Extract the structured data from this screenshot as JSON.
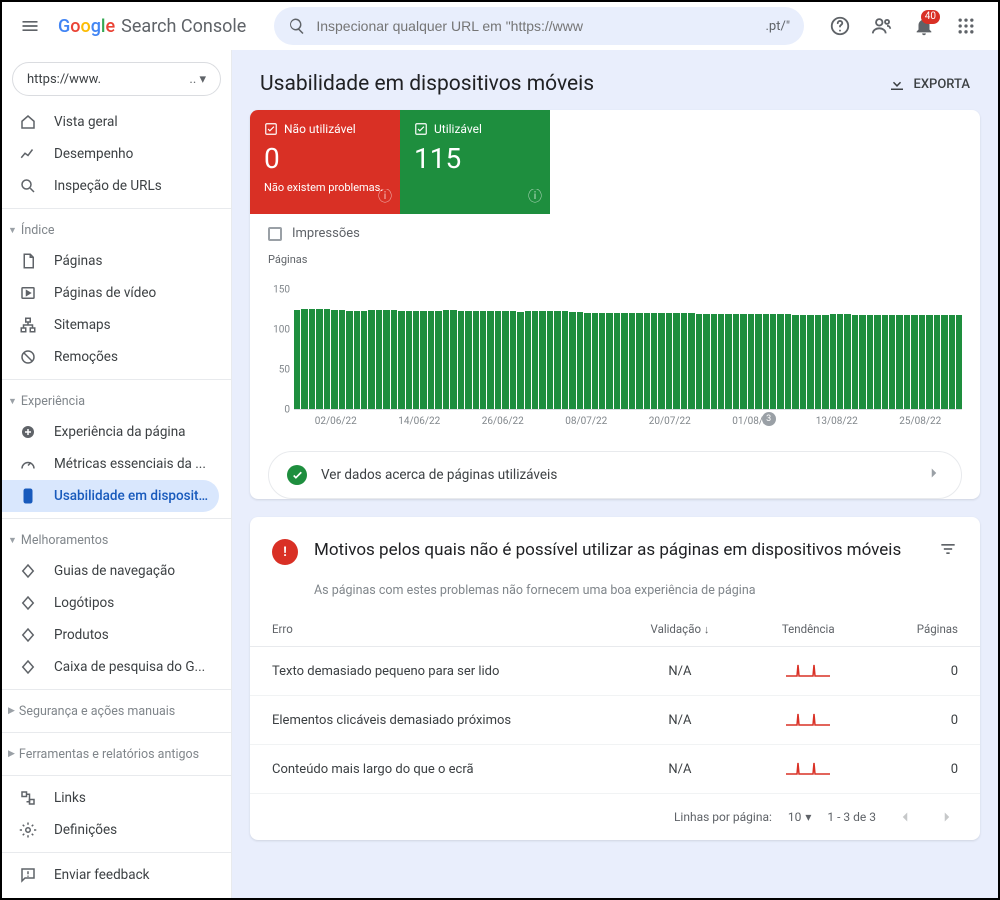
{
  "header": {
    "product": "Search Console",
    "search_placeholder": "Inspecionar qualquer URL em \"https://www",
    "search_suffix": ".pt/\"",
    "notif_count": "40"
  },
  "property": {
    "label": "https://www.",
    "suffix": ".. ▾"
  },
  "sidebar": {
    "items_top": [
      {
        "label": "Vista geral",
        "icon": "home"
      },
      {
        "label": "Desempenho",
        "icon": "trend"
      },
      {
        "label": "Inspeção de URLs",
        "icon": "search"
      }
    ],
    "group_indice": "Índice",
    "items_indice": [
      {
        "label": "Páginas",
        "icon": "page"
      },
      {
        "label": "Páginas de vídeo",
        "icon": "video"
      },
      {
        "label": "Sitemaps",
        "icon": "sitemap"
      },
      {
        "label": "Remoções",
        "icon": "remove"
      }
    ],
    "group_exp": "Experiência",
    "items_exp": [
      {
        "label": "Experiência da página",
        "icon": "plus"
      },
      {
        "label": "Métricas essenciais da ...",
        "icon": "speed"
      },
      {
        "label": "Usabilidade em dispositi...",
        "icon": "mobile",
        "selected": true
      }
    ],
    "group_melh": "Melhoramentos",
    "items_melh": [
      {
        "label": "Guias de navegação",
        "icon": "diamond"
      },
      {
        "label": "Logótipos",
        "icon": "diamond"
      },
      {
        "label": "Produtos",
        "icon": "diamond"
      },
      {
        "label": "Caixa de pesquisa do G...",
        "icon": "diamond"
      }
    ],
    "group_sec": "Segurança e ações manuais",
    "group_tools": "Ferramentas e relatórios antigos",
    "items_bottom": [
      {
        "label": "Links",
        "icon": "links"
      },
      {
        "label": "Definições",
        "icon": "gear"
      }
    ],
    "feedback": "Enviar feedback"
  },
  "page": {
    "title": "Usabilidade em dispositivos móveis",
    "export": "EXPORTA"
  },
  "tiles": {
    "not_usable": {
      "label": "Não utilizável",
      "count": "0",
      "note": "Não existem problemas."
    },
    "usable": {
      "label": "Utilizável",
      "count": "115"
    }
  },
  "impressions_label": "Impressões",
  "chart_data": {
    "type": "bar",
    "title": "",
    "ylabel": "Páginas",
    "xlabel": "",
    "ylim": [
      0,
      150
    ],
    "yticks": [
      0,
      50,
      100,
      150
    ],
    "categories": [
      "02/06/22",
      "14/06/22",
      "26/06/22",
      "08/07/22",
      "20/07/22",
      "01/08/22",
      "13/08/22",
      "25/08/22"
    ],
    "marker": {
      "label": "3",
      "position_ratio": 0.7
    },
    "values": [
      124,
      125,
      125,
      125,
      125,
      124,
      124,
      123,
      123,
      123,
      124,
      124,
      124,
      124,
      123,
      123,
      122,
      123,
      123,
      123,
      124,
      124,
      123,
      122,
      122,
      122,
      122,
      122,
      122,
      122,
      121,
      122,
      122,
      122,
      122,
      122,
      122,
      121,
      121,
      120,
      120,
      120,
      120,
      120,
      120,
      120,
      120,
      120,
      120,
      120,
      120,
      120,
      120,
      120,
      119,
      119,
      119,
      119,
      119,
      119,
      119,
      119,
      119,
      119,
      119,
      119,
      119,
      118,
      118,
      118,
      118,
      118,
      119,
      119,
      119,
      118,
      118,
      118,
      118,
      118,
      118,
      118,
      118,
      118,
      117,
      117,
      117,
      117,
      117,
      117
    ]
  },
  "good_link": "Ver dados acerca de páginas utilizáveis",
  "issues": {
    "title": "Motivos pelos quais não é possível utilizar as páginas em dispositivos móveis",
    "subtitle": "As páginas com estes problemas não fornecem uma boa experiência de página",
    "columns": {
      "err": "Erro",
      "val": "Validação",
      "trend": "Tendência",
      "pages": "Páginas"
    },
    "rows": [
      {
        "err": "Texto demasiado pequeno para ser lido",
        "val": "N/A",
        "pages": "0"
      },
      {
        "err": "Elementos clicáveis demasiado próximos",
        "val": "N/A",
        "pages": "0"
      },
      {
        "err": "Conteúdo mais largo do que o ecrã",
        "val": "N/A",
        "pages": "0"
      }
    ]
  },
  "pager": {
    "per": "Linhas por página:",
    "count": "10",
    "range": "1 - 3 de 3"
  }
}
